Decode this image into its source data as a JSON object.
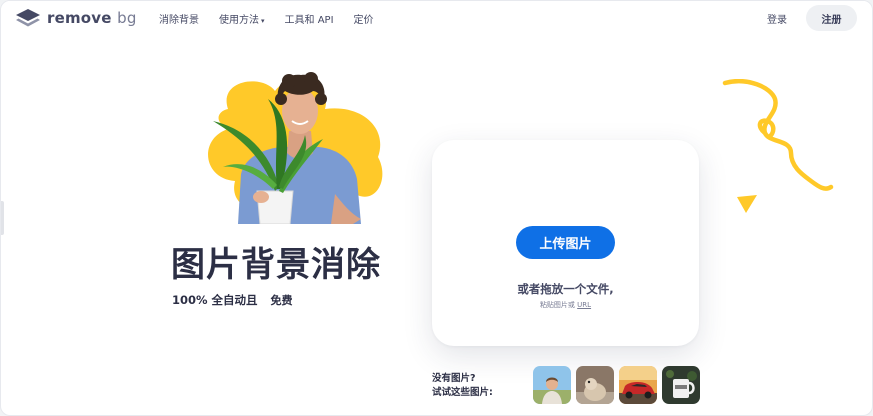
{
  "header": {
    "logo_text_1": "remove",
    "logo_text_2": "bg",
    "nav": [
      {
        "label": "消除背景"
      },
      {
        "label": "使用方法",
        "has_dropdown": true
      },
      {
        "label": "工具和 API"
      },
      {
        "label": "定价"
      }
    ],
    "login_label": "登录",
    "signup_label": "注册"
  },
  "hero": {
    "title": "图片背景消除",
    "subtitle_lead": "100% 全自动且",
    "badge": "免费"
  },
  "upload": {
    "button_label": "上传图片",
    "drop_text": "或者拖放一个文件,",
    "paste_text": "粘贴图片或",
    "paste_link": "URL"
  },
  "samples": {
    "line1": "没有图片?",
    "line2": "试试这些图片:",
    "thumbs": [
      "person-thumbnail",
      "animal-thumbnail",
      "car-thumbnail",
      "mug-thumbnail"
    ]
  },
  "colors": {
    "accent_blue": "#0f70e6",
    "accent_yellow": "#ffc929",
    "text_dark": "#2c2f45",
    "text_body": "#454964"
  }
}
